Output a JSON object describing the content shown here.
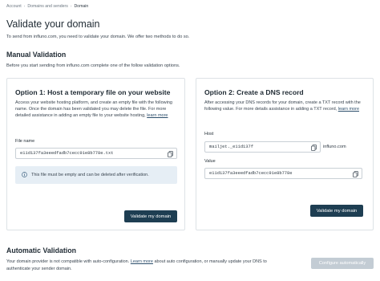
{
  "breadcrumb": {
    "items": [
      "Account",
      "Domains and senders",
      "Domain"
    ]
  },
  "page": {
    "title": "Validate your domain",
    "intro": "To send from influno.com, you need to validate your domain. We offer two methods to do so."
  },
  "manual": {
    "title": "Manual Validation",
    "description": "Before you start sending from influno.com complete one of the follow validation options."
  },
  "option1": {
    "title": "Option 1: Host a temporary file on your website",
    "description": "Access your website hosting platform, and create an empty file with the following name. Once the domain has been validated you may delete the file. For more detailed assistance in adding an empty file to your website hosting,",
    "link": "learn more",
    "file_label": "File name",
    "file_value": "e11d137fa3eeedfadb7cecc91e8b778e.txt",
    "info": "This file must be empty and can be deleted after verification.",
    "button": "Validate my domain"
  },
  "option2": {
    "title": "Option 2: Create a DNS record",
    "description": "After accessing your DNS records for your domain, create a TXT record with the following value. For more details assistance in adding a TXT record,",
    "link": "learn more",
    "host_label": "Host",
    "host_value": "mailjet._e11d137f",
    "host_suffix": "influno.com",
    "value_label": "Value",
    "value_value": "e11d137fa3eeedfadb7cecc91e8b778e",
    "button": "Validate my domain"
  },
  "automatic": {
    "title": "Automatic Validation",
    "desc_before": "Your domain provider is not compatible with auto-configuration.",
    "link": "Learn more",
    "desc_after": "about auto configuration, or manually update your DNS to authenticate your sender domain.",
    "button": "Configure automatically"
  },
  "icons": {
    "breadcrumb_separator": "chevron-right-icon",
    "copy": "copy-icon",
    "info": "info-icon"
  },
  "colors": {
    "primary_button": "#1e3e52",
    "disabled_button": "#c3ccd4",
    "info_background": "#e6eef5",
    "link": "#2c4e6b"
  }
}
